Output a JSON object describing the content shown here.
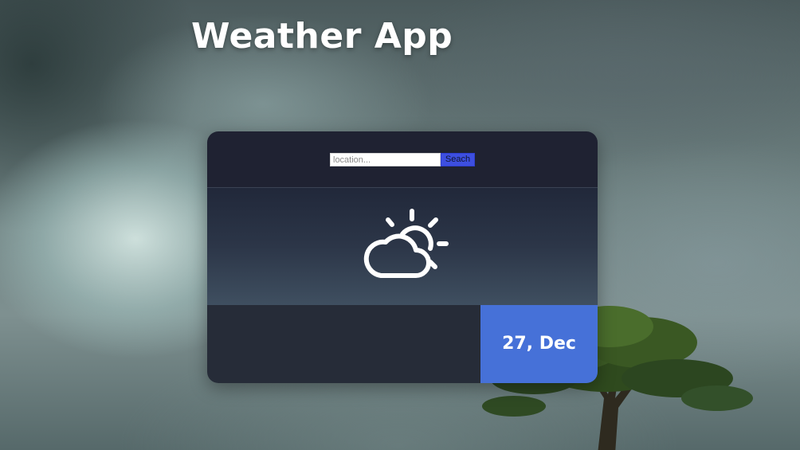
{
  "app": {
    "title": "Weather App"
  },
  "search": {
    "placeholder": "location...",
    "value": "",
    "button_label": "Seach"
  },
  "weather": {
    "icon": "partly-cloudy-icon"
  },
  "date": {
    "label": "27, Dec"
  },
  "colors": {
    "card_top": "#1f2232",
    "card_bottom": "#262c38",
    "date_panel": "#4671d8",
    "search_button": "#3d4fe0",
    "text": "#ffffff"
  }
}
